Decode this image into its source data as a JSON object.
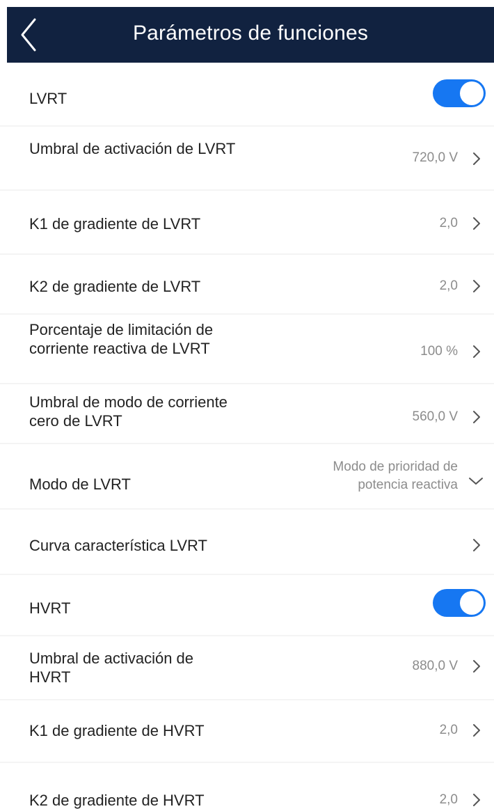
{
  "header": {
    "title": "Parámetros de funciones"
  },
  "rows": {
    "lvrt": {
      "label": "LVRT",
      "toggle_on": true
    },
    "lvrt_activation_threshold": {
      "label": "Umbral de activación de LVRT",
      "value": "720,0 V"
    },
    "lvrt_k1": {
      "label": "K1 de gradiente de LVRT",
      "value": "2,0"
    },
    "lvrt_k2": {
      "label": "K2 de gradiente de LVRT",
      "value": "2,0"
    },
    "lvrt_reactive_current_limit": {
      "label": "Porcentaje de limitación de corriente reactiva de LVRT",
      "value": "100 %"
    },
    "lvrt_zero_current_threshold": {
      "label": "Umbral de modo de corriente cero de LVRT",
      "value": "560,0 V"
    },
    "lvrt_mode": {
      "label": "Modo de LVRT",
      "value": "Modo de prioridad de potencia reactiva"
    },
    "lvrt_curve": {
      "label": "Curva característica LVRT"
    },
    "hvrt": {
      "label": "HVRT",
      "toggle_on": true
    },
    "hvrt_activation_threshold": {
      "label": "Umbral de activación de HVRT",
      "value": "880,0 V"
    },
    "hvrt_k1": {
      "label": "K1 de gradiente de HVRT",
      "value": "2,0"
    },
    "hvrt_k2": {
      "label": "K2 de gradiente de HVRT",
      "value": "2,0"
    }
  },
  "icons": {
    "back": "chevron-left-icon",
    "row_arrow": "chevron-right-icon",
    "dropdown": "chevron-down-icon"
  },
  "colors": {
    "header_bg": "#112240",
    "toggle_on": "#1677f2",
    "label_text": "#222222",
    "value_text": "#8c8c8c"
  }
}
